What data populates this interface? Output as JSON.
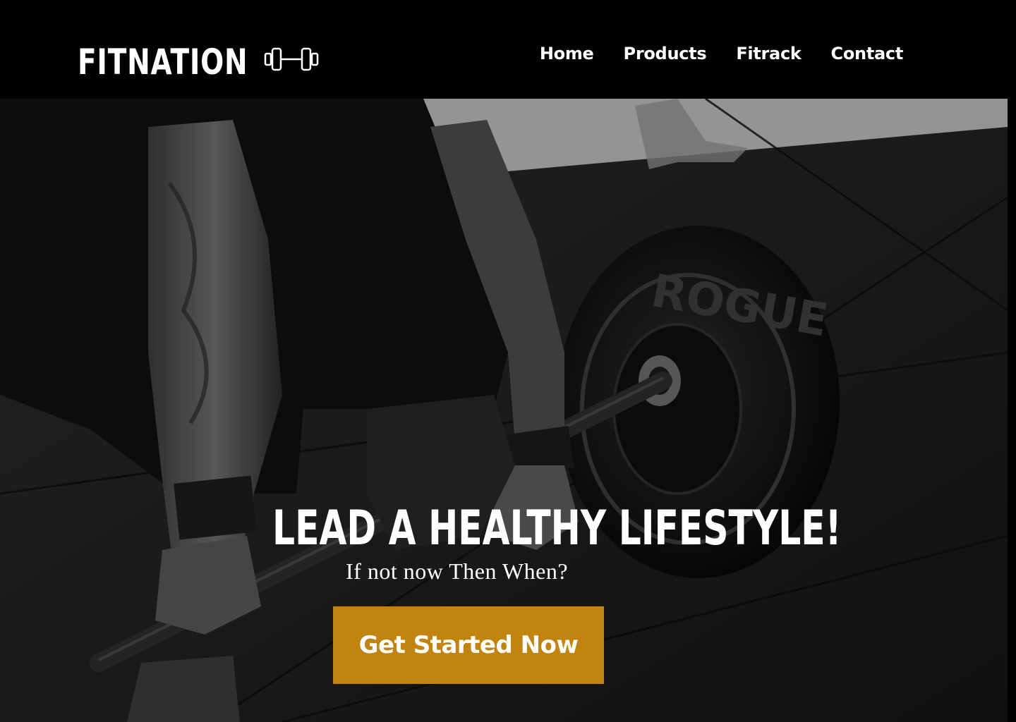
{
  "brand": {
    "name": "FITNATION",
    "icon": "dumbbell-icon"
  },
  "nav": {
    "items": [
      {
        "label": "Home"
      },
      {
        "label": "Products"
      },
      {
        "label": "Fitrack"
      },
      {
        "label": "Contact"
      }
    ]
  },
  "hero": {
    "title": "LEAD A HEALTHY LIFESTYLE!",
    "subtitle": "If not now Then When?",
    "cta_label": "Get Started Now",
    "image": "deadlift-barbell-photo",
    "plate_lettering": "ROGUE"
  },
  "colors": {
    "navbar_bg": "#000000",
    "accent": "#c0840f",
    "text": "#ffffff"
  }
}
